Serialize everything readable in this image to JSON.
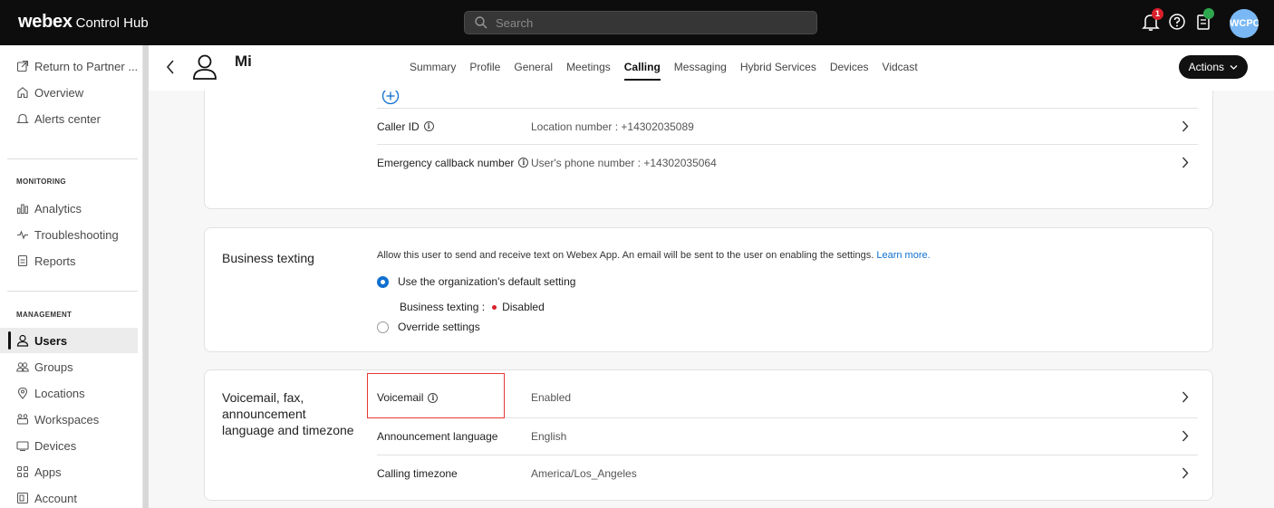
{
  "brand": {
    "name": "webex",
    "product": "Control Hub"
  },
  "search": {
    "placeholder": "Search"
  },
  "topbar": {
    "notification_count": "1",
    "avatar_initials": "WCPC"
  },
  "sidebar": {
    "top_items": [
      {
        "label": "Return to Partner ...",
        "icon": "external-link-icon"
      },
      {
        "label": "Overview",
        "icon": "home-icon"
      },
      {
        "label": "Alerts center",
        "icon": "bell-icon"
      }
    ],
    "monitoring_label": "MONITORING",
    "monitoring_items": [
      {
        "label": "Analytics",
        "icon": "analytics-icon"
      },
      {
        "label": "Troubleshooting",
        "icon": "pulse-icon"
      },
      {
        "label": "Reports",
        "icon": "document-icon"
      }
    ],
    "management_label": "MANAGEMENT",
    "management_items": [
      {
        "label": "Users",
        "icon": "user-icon",
        "active": true
      },
      {
        "label": "Groups",
        "icon": "groups-icon"
      },
      {
        "label": "Locations",
        "icon": "location-icon"
      },
      {
        "label": "Workspaces",
        "icon": "workspaces-icon"
      },
      {
        "label": "Devices",
        "icon": "devices-icon"
      },
      {
        "label": "Apps",
        "icon": "apps-icon"
      },
      {
        "label": "Account",
        "icon": "account-icon"
      }
    ]
  },
  "header": {
    "user_name": "Mi",
    "tabs": [
      "Summary",
      "Profile",
      "General",
      "Meetings",
      "Calling",
      "Messaging",
      "Hybrid Services",
      "Devices",
      "Vidcast"
    ],
    "active_tab": "Calling",
    "actions_label": "Actions"
  },
  "caller_card": {
    "rows": [
      {
        "label": "Caller ID",
        "value": "Location number : +14302035089"
      },
      {
        "label": "Emergency callback number",
        "value": "User's phone number : +14302035064"
      }
    ]
  },
  "business_texting": {
    "title": "Business texting",
    "description": "Allow this user to send and receive text on Webex App. An email will be sent to the user on enabling the settings.",
    "learn_more": "Learn more.",
    "option_default": "Use the organization's default setting",
    "status_label": "Business texting :",
    "status_value": "Disabled",
    "option_override": "Override settings"
  },
  "voicemail_card": {
    "title": "Voicemail, fax, announcement language and timezone",
    "rows": [
      {
        "label": "Voicemail",
        "value": "Enabled"
      },
      {
        "label": "Announcement language",
        "value": "English"
      },
      {
        "label": "Calling timezone",
        "value": "America/Los_Angeles"
      }
    ]
  },
  "colors": {
    "accent": "#1170cf",
    "highlight": "#e53935",
    "topbar": "#0d0d0d"
  }
}
